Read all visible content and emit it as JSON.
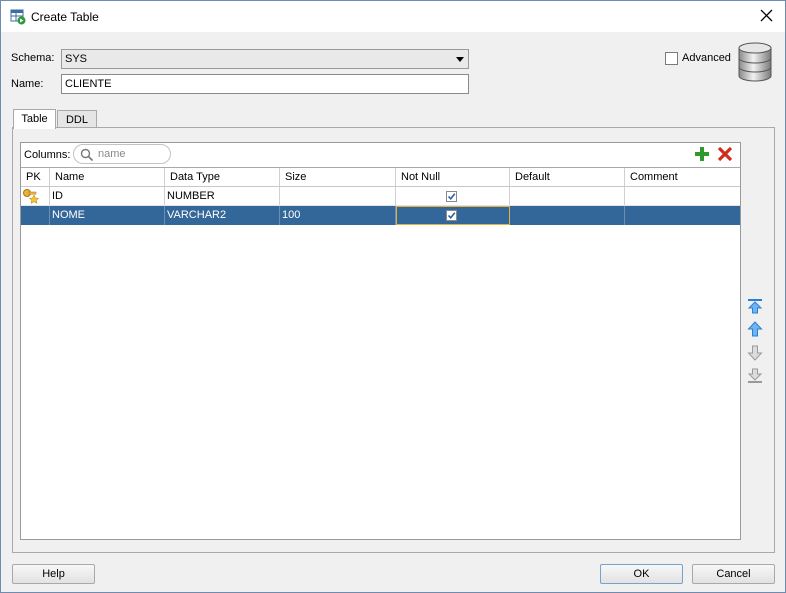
{
  "window": {
    "title": "Create Table"
  },
  "form": {
    "schema_label": "Schema:",
    "schema_value": "SYS",
    "name_label": "Name:",
    "name_value": "CLIENTE",
    "advanced_label": "Advanced",
    "advanced_checked": false
  },
  "tabs": [
    {
      "label": "Table",
      "active": true
    },
    {
      "label": "DDL",
      "active": false
    }
  ],
  "columns_panel": {
    "label": "Columns:",
    "search_placeholder": "name"
  },
  "grid": {
    "headers": [
      "PK",
      "Name",
      "Data Type",
      "Size",
      "Not Null",
      "Default",
      "Comment"
    ],
    "rows": [
      {
        "pk": true,
        "name": "ID",
        "data_type": "NUMBER",
        "size": "",
        "not_null": true,
        "default": "",
        "comment": "",
        "selected": false
      },
      {
        "pk": false,
        "name": "NOME",
        "data_type": "VARCHAR2",
        "size": "100",
        "not_null": true,
        "default": "",
        "comment": "",
        "selected": true
      }
    ]
  },
  "buttons": {
    "help": "Help",
    "ok": "OK",
    "cancel": "Cancel"
  },
  "icons": {
    "add": "plus-icon",
    "remove": "delete-icon",
    "move_top": "move-top-icon",
    "move_up": "move-up-icon",
    "move_down": "move-down-icon",
    "move_bottom": "move-bottom-icon"
  },
  "colors": {
    "selection": "#336699",
    "accent_blue": "#2a7fd4"
  }
}
